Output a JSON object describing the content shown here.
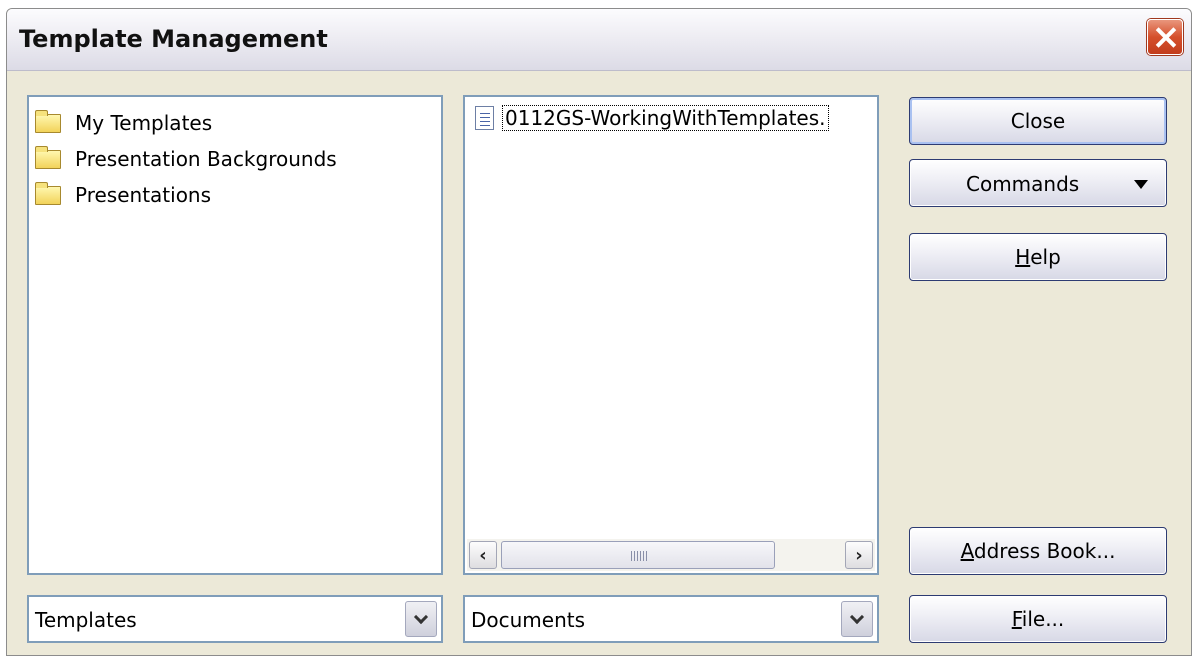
{
  "window": {
    "title": "Template Management"
  },
  "categories": {
    "items": [
      {
        "label": "My Templates"
      },
      {
        "label": "Presentation Backgrounds"
      },
      {
        "label": "Presentations"
      }
    ]
  },
  "documents": {
    "items": [
      {
        "label": "0112GS-WorkingWithTemplates."
      }
    ]
  },
  "left_combo": {
    "value": "Templates"
  },
  "right_combo": {
    "value": "Documents"
  },
  "buttons": {
    "close": "Close",
    "commands": "Commands",
    "help_access": "H",
    "help_rest": "elp",
    "address_access": "A",
    "address_rest": "ddress Book...",
    "file_access": "F",
    "file_rest": "ile..."
  },
  "icons": {
    "close": "close-x-icon",
    "folder": "folder-icon",
    "document": "document-icon",
    "scroll_left": "arrow-left-icon",
    "scroll_right": "arrow-right-icon",
    "dropdown": "chevron-down-icon"
  },
  "colors": {
    "dialog_bg": "#ece9d8",
    "panel_border": "#7f9db9",
    "close_button_red": "#d5502c"
  }
}
